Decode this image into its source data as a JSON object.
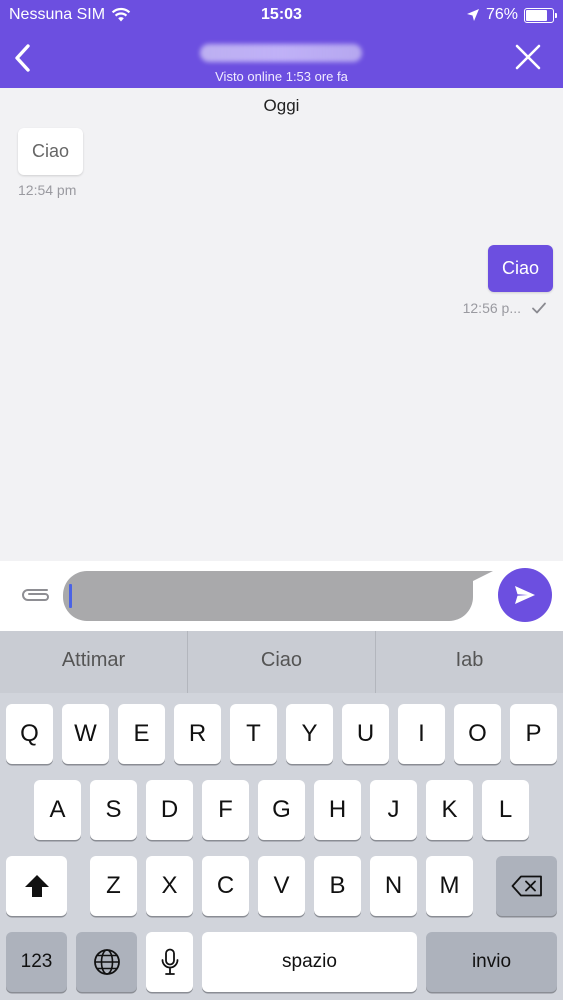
{
  "status_bar": {
    "carrier": "Nessuna SIM",
    "time": "15:03",
    "battery": "76%",
    "battery_level": 0.76
  },
  "header": {
    "last_seen": "Visto online 1:53 ore fa"
  },
  "chat": {
    "day_label": "Oggi",
    "messages": [
      {
        "direction": "in",
        "text": "Ciao",
        "time": "12:54 pm"
      },
      {
        "direction": "out",
        "text": "Ciao",
        "time": "12:56 p..."
      }
    ]
  },
  "composer": {
    "value": ""
  },
  "keyboard": {
    "suggestions": [
      "Attimar",
      "Ciao",
      "Iab"
    ],
    "row1": [
      "Q",
      "W",
      "E",
      "R",
      "T",
      "Y",
      "U",
      "I",
      "O",
      "P"
    ],
    "row2": [
      "A",
      "S",
      "D",
      "F",
      "G",
      "H",
      "J",
      "K",
      "L"
    ],
    "row3": [
      "Z",
      "X",
      "C",
      "V",
      "B",
      "N",
      "M"
    ],
    "numbers_label": "123",
    "space_label": "spazio",
    "return_label": "invio"
  },
  "colors": {
    "accent": "#6c4fe0",
    "chat_background": "#f2f2f4",
    "input_background": "#a9a9ab"
  }
}
